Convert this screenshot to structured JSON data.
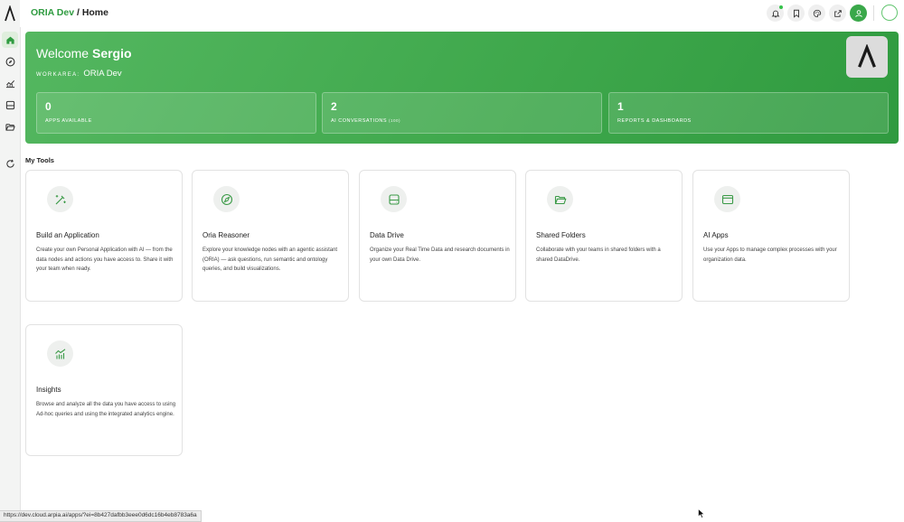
{
  "breadcrumb": {
    "app": "ORIA Dev",
    "separator": " / ",
    "page": "Home"
  },
  "hero": {
    "welcome_prefix": "Welcome ",
    "user_name": "Sergio",
    "workarea_label": "WORKAREA:",
    "workarea_value": "ORIA Dev",
    "stats": [
      {
        "value": "0",
        "label": "APPS AVAILABLE",
        "note": ""
      },
      {
        "value": "2",
        "label": "AI CONVERSATIONS",
        "note": "(100)"
      },
      {
        "value": "1",
        "label": "REPORTS & DASHBOARDS",
        "note": ""
      }
    ]
  },
  "tools": {
    "title": "My Tools",
    "cards": [
      {
        "icon": "magic-wand-icon",
        "title": "Build an Application",
        "description": "Create your own Personal Application with AI — from the data nodes and actions you have access to. Share it with your team when ready."
      },
      {
        "icon": "compass-icon",
        "title": "Oria Reasoner",
        "description": "Explore your knowledge nodes with an agentic assistant (ORIA) — ask questions, run semantic and ontology queries, and build visualizations."
      },
      {
        "icon": "drive-icon",
        "title": "Data Drive",
        "description": "Organize your Real Time Data and research documents in your own Data Drive."
      },
      {
        "icon": "folder-open-icon",
        "title": "Shared Folders",
        "description": "Collaborate with your teams in shared folders with a shared DataDrive."
      },
      {
        "icon": "app-window-icon",
        "title": "AI Apps",
        "description": "Use your Apps to manage complex processes with your organization data."
      },
      {
        "icon": "chart-line-icon",
        "title": "Insights",
        "description": "Browse and analyze all the data you have access to using Ad-hoc queries and using the integrated analytics engine."
      }
    ]
  },
  "status_url": "https://dev.cloud.arpia.ai/apps/?ei=8b427dafbb3eee0d6dc16b4eb8783a6a",
  "colors": {
    "accent": "#3aa84a",
    "accent_dark": "#2f9b40",
    "icon_green": "#3a9a46"
  }
}
